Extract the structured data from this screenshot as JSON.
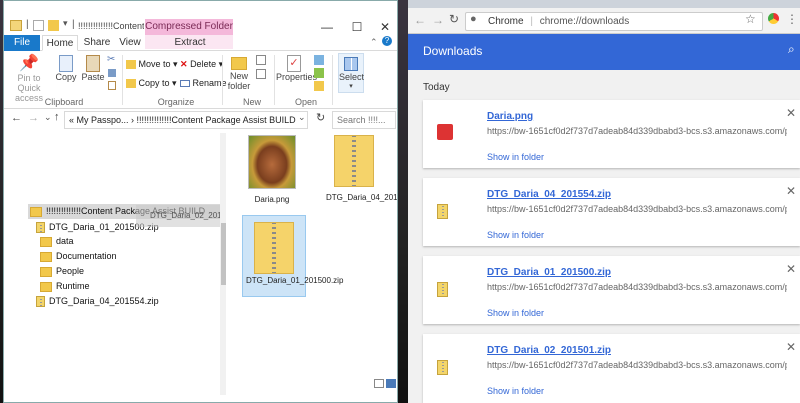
{
  "explorer": {
    "title": "!!!!!!!!!!!!!!Content Pac...",
    "context_tab": "Compressed Folder Tools",
    "tabs": {
      "file": "File",
      "home": "Home",
      "share": "Share",
      "view": "View",
      "extract": "Extract"
    },
    "ribbon": {
      "pin": "Pin to Quick access",
      "copy": "Copy",
      "paste": "Paste",
      "move_to": "Move to",
      "copy_to": "Copy to",
      "delete": "Delete",
      "rename": "Rename",
      "new_folder": "New folder",
      "properties": "Properties",
      "select": "Select",
      "groups": {
        "clipboard": "Clipboard",
        "organize": "Organize",
        "new": "New",
        "open": "Open"
      }
    },
    "address": "« My Passpo... › !!!!!!!!!!!!!!Content Package Assist BUILD",
    "search_placeholder": "Search !!!!...",
    "tree": [
      {
        "label": "!!!!!!!!!!!!!!Content Package Assist BUILD",
        "type": "folder"
      },
      {
        "label": "DTG_Daria_01_201500.zip",
        "type": "zip"
      },
      {
        "label": "data",
        "type": "folder"
      },
      {
        "label": "Documentation",
        "type": "folder"
      },
      {
        "label": "People",
        "type": "folder"
      },
      {
        "label": "Runtime",
        "type": "folder"
      },
      {
        "label": "DTG_Daria_04_201554.zip",
        "type": "zip"
      }
    ],
    "drag_label": "DTG_Daria_02_201...",
    "files": [
      {
        "name": "Daria.png",
        "type": "image"
      },
      {
        "name": "DTG_Daria_04_201554.zip",
        "type": "zip"
      },
      {
        "name": "DTG_Daria_01_201500.zip",
        "type": "zip"
      }
    ]
  },
  "chrome": {
    "site": "Chrome",
    "url": "chrome://downloads",
    "header": "Downloads",
    "section": "Today",
    "downloads": [
      {
        "name": "Daria.png",
        "url": "https://bw-1651cf0d2f737d7adeab84d339dbabd3-bcs.s3.amazonaws.com/produ...",
        "action": "Show in folder",
        "type": "image"
      },
      {
        "name": "DTG_Daria_04_201554.zip",
        "url": "https://bw-1651cf0d2f737d7adeab84d339dbabd3-bcs.s3.amazonaws.com/produ...",
        "action": "Show in folder",
        "type": "zip"
      },
      {
        "name": "DTG_Daria_01_201500.zip",
        "url": "https://bw-1651cf0d2f737d7adeab84d339dbabd3-bcs.s3.amazonaws.com/produ...",
        "action": "Show in folder",
        "type": "zip"
      },
      {
        "name": "DTG_Daria_02_201501.zip",
        "url": "https://bw-1651cf0d2f737d7adeab84d339dbabd3-bcs.s3.amazonaws.com/produ...",
        "action": "Show in folder",
        "type": "zip"
      }
    ]
  },
  "colors": {
    "chrome_header": "#3367d6",
    "link": "#3367d6",
    "file_tab": "#1979ca",
    "context_tab": "#f4b8da"
  }
}
